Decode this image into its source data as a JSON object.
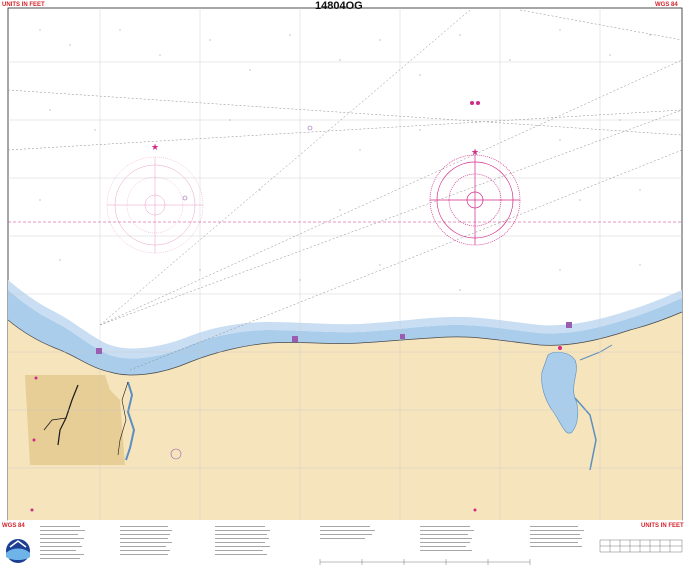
{
  "chart": {
    "title": "14804OG",
    "units_left": "UNITS IN FEET",
    "units_right": "UNITS IN FEET",
    "datum_left": "WGS 84",
    "datum_right": "WGS 84",
    "datum_bottom_left": "WGS 84",
    "units_bottom_right": "UNITS IN FEET",
    "agency_logo": "NOAA"
  },
  "colors": {
    "water": "#ffffff",
    "land": "#f6e4bd",
    "shallow": "#a9cdea",
    "shoal": "#c9def2",
    "magenta": "#d12a87",
    "grid": "#b6b6b6",
    "red_text": "#d2232a"
  },
  "icons": [
    "compass-rose-icon",
    "magenta-star-icon",
    "buoy-icon",
    "noaa-logo-icon",
    "light-beacon-icon"
  ]
}
